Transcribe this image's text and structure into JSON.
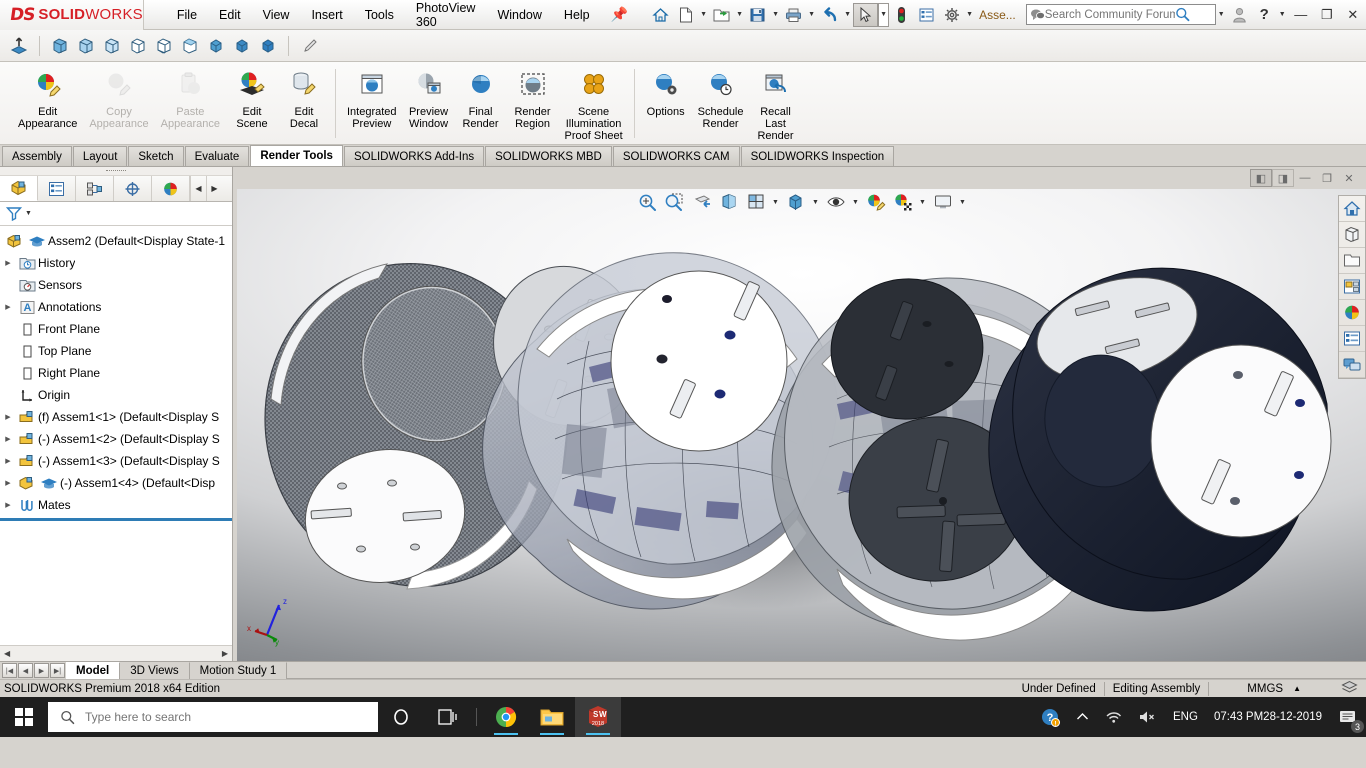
{
  "app": {
    "brand_mark": "DS",
    "brand_bold": "SOLID",
    "brand_light": "WORKS",
    "accent_red": "#d61f26",
    "accent_blue": "#2e7cb5"
  },
  "menubar": {
    "items": [
      "File",
      "Edit",
      "View",
      "Insert",
      "Tools",
      "PhotoView 360",
      "Window",
      "Help"
    ],
    "pin_icon": "pushpin-icon"
  },
  "quick_access": {
    "icons": [
      "home-icon",
      "new-document-icon",
      "open-folder-icon",
      "save-icon",
      "print-icon",
      "undo-icon",
      "select-pointer-icon",
      "rebuild-icon",
      "options-list-icon",
      "settings-gear-icon"
    ],
    "context_label": "Asse...",
    "search": {
      "placeholder": "Search Community Forum",
      "icon": "search-magnifier-icon",
      "chat_icon": "chat-bubble-icon"
    },
    "user_icon": "user-account-icon",
    "help_icon": "help-question-icon"
  },
  "window_controls": {
    "minimize": "—",
    "restore": "❐",
    "close": "✕"
  },
  "toolbar2": {
    "icons": [
      "extrude-boss-icon",
      "view-isometric-1-icon",
      "view-isometric-2-icon",
      "view-isometric-3-icon",
      "view-wireframe-icon",
      "view-shaded-edges-icon",
      "view-hidden-lines-icon",
      "cube-solid-1-icon",
      "cube-solid-2-icon",
      "cube-solid-3-icon",
      "appearance-brush-icon"
    ]
  },
  "ribbon": {
    "groups": [
      {
        "buttons": [
          {
            "label": "Edit\nAppearance",
            "icon": "edit-appearance-icon",
            "disabled": false
          },
          {
            "label": "Copy\nAppearance",
            "icon": "copy-appearance-icon",
            "disabled": true
          },
          {
            "label": "Paste\nAppearance",
            "icon": "paste-appearance-icon",
            "disabled": true
          },
          {
            "label": "Edit\nScene",
            "icon": "edit-scene-icon",
            "disabled": false
          },
          {
            "label": "Edit\nDecal",
            "icon": "edit-decal-icon",
            "disabled": false
          }
        ]
      },
      {
        "buttons": [
          {
            "label": "Integrated\nPreview",
            "icon": "integrated-preview-icon",
            "disabled": false
          },
          {
            "label": "Preview\nWindow",
            "icon": "preview-window-icon",
            "disabled": false
          },
          {
            "label": "Final\nRender",
            "icon": "final-render-icon",
            "disabled": false
          },
          {
            "label": "Render\nRegion",
            "icon": "render-region-icon",
            "disabled": false
          },
          {
            "label": "Scene\nIllumination\nProof Sheet",
            "icon": "scene-illumination-icon",
            "disabled": false
          }
        ]
      },
      {
        "buttons": [
          {
            "label": "Options",
            "icon": "render-options-icon",
            "disabled": false
          },
          {
            "label": "Schedule\nRender",
            "icon": "schedule-render-icon",
            "disabled": false
          },
          {
            "label": "Recall\nLast\nRender",
            "icon": "recall-last-render-icon",
            "disabled": false
          }
        ]
      }
    ]
  },
  "command_tabs": {
    "items": [
      {
        "label": "Assembly",
        "active": false
      },
      {
        "label": "Layout",
        "active": false
      },
      {
        "label": "Sketch",
        "active": false
      },
      {
        "label": "Evaluate",
        "active": false
      },
      {
        "label": "Render Tools",
        "active": true
      },
      {
        "label": "SOLIDWORKS Add-Ins",
        "active": false
      },
      {
        "label": "SOLIDWORKS MBD",
        "active": false
      },
      {
        "label": "SOLIDWORKS CAM",
        "active": false
      },
      {
        "label": "SOLIDWORKS Inspection",
        "active": false
      }
    ]
  },
  "feature_manager": {
    "panel_tabs": [
      {
        "icon": "feature-tree-icon",
        "active": true
      },
      {
        "icon": "property-manager-icon",
        "active": false
      },
      {
        "icon": "configuration-manager-icon",
        "active": false
      },
      {
        "icon": "dimxpert-manager-icon",
        "active": false
      },
      {
        "icon": "display-manager-icon",
        "active": false
      }
    ],
    "panel_arrows": {
      "left": "◀",
      "right": "▶"
    },
    "filter": {
      "icon": "filter-funnel-icon",
      "placeholder": ""
    },
    "tree": [
      {
        "label": "Assem2  (Default<Display State-1",
        "icon": "assembly-icon",
        "extra_icon": "graduation-cap-icon",
        "arrow": false,
        "indent": 0
      },
      {
        "label": "History",
        "icon": "history-folder-icon",
        "arrow": true,
        "indent": 1
      },
      {
        "label": "Sensors",
        "icon": "sensors-folder-icon",
        "arrow": false,
        "indent": 1
      },
      {
        "label": "Annotations",
        "icon": "annotations-icon",
        "arrow": true,
        "indent": 1
      },
      {
        "label": "Front Plane",
        "icon": "plane-icon",
        "arrow": false,
        "indent": 1
      },
      {
        "label": "Top Plane",
        "icon": "plane-icon",
        "arrow": false,
        "indent": 1
      },
      {
        "label": "Right Plane",
        "icon": "plane-icon",
        "arrow": false,
        "indent": 1
      },
      {
        "label": "Origin",
        "icon": "origin-icon",
        "arrow": false,
        "indent": 1
      },
      {
        "label": "(f) Assem1<1>  (Default<Display S",
        "icon": "subassembly-icon",
        "arrow": true,
        "indent": 0
      },
      {
        "label": "(-) Assem1<2>  (Default<Display S",
        "icon": "subassembly-icon",
        "arrow": true,
        "indent": 0
      },
      {
        "label": "(-) Assem1<3>  (Default<Display S",
        "icon": "subassembly-icon",
        "arrow": true,
        "indent": 0
      },
      {
        "label": "(-) Assem1<4>  (Default<Disp",
        "icon": "assembly-icon",
        "extra_icon": "graduation-cap-icon",
        "arrow": true,
        "indent": 0
      },
      {
        "label": "Mates",
        "icon": "mates-icon",
        "arrow": true,
        "indent": 0
      }
    ]
  },
  "graphics_window": {
    "window_controls": [
      "restore-left-icon",
      "restore-right-icon",
      "minimize-icon",
      "restore-icon",
      "close-icon"
    ],
    "view_toolbar": [
      "zoom-to-fit-icon",
      "zoom-to-area-icon",
      "previous-view-icon",
      "section-view-icon",
      "view-orientation-icon",
      "display-style-icon",
      "hide-show-items-icon",
      "edit-appearance-icon",
      "apply-scene-icon",
      "view-settings-icon"
    ],
    "triad_axes": {
      "x": "x",
      "y": "y",
      "z": "z"
    }
  },
  "task_pane": {
    "icons": [
      "home-resources-icon",
      "design-library-icon",
      "file-explorer-icon",
      "view-palette-icon",
      "appearances-scenes-icon",
      "custom-properties-icon",
      "solidworks-forum-icon"
    ]
  },
  "bottom_tabs": {
    "nav_buttons": [
      "first-icon",
      "previous-icon",
      "next-icon",
      "last-icon"
    ],
    "items": [
      {
        "label": "Model",
        "active": true
      },
      {
        "label": "3D Views",
        "active": false
      },
      {
        "label": "Motion Study 1",
        "active": false
      }
    ]
  },
  "status_bar": {
    "edition": "SOLIDWORKS Premium 2018 x64 Edition",
    "sketch_state": "Under Defined",
    "edit_mode": "Editing Assembly",
    "units": "MMGS",
    "units_caret": "▲",
    "overlay_icon": "overlay-layers-icon"
  },
  "taskbar": {
    "start_icon": "windows-start-icon",
    "search": {
      "placeholder": "Type here to search",
      "icon": "search-magnifier-icon"
    },
    "buttons": [
      {
        "icon": "cortana-circle-icon",
        "running": false,
        "active": false
      },
      {
        "icon": "task-view-icon",
        "running": false,
        "active": false
      },
      {
        "icon": "chrome-icon",
        "running": true,
        "active": false
      },
      {
        "icon": "file-explorer-icon",
        "running": true,
        "active": false
      },
      {
        "icon": "solidworks-2018-icon",
        "running": true,
        "active": true
      }
    ],
    "tray": {
      "action_center_icon": "help-notification-icon",
      "chevron_icon": "show-hidden-icons-icon",
      "network_icon": "wifi-icon",
      "volume_icon": "volume-muted-icon",
      "language": "ENG",
      "time": "07:43 PM",
      "date": "28-12-2019",
      "notifications_icon": "notifications-icon",
      "notifications_count": "3"
    }
  }
}
